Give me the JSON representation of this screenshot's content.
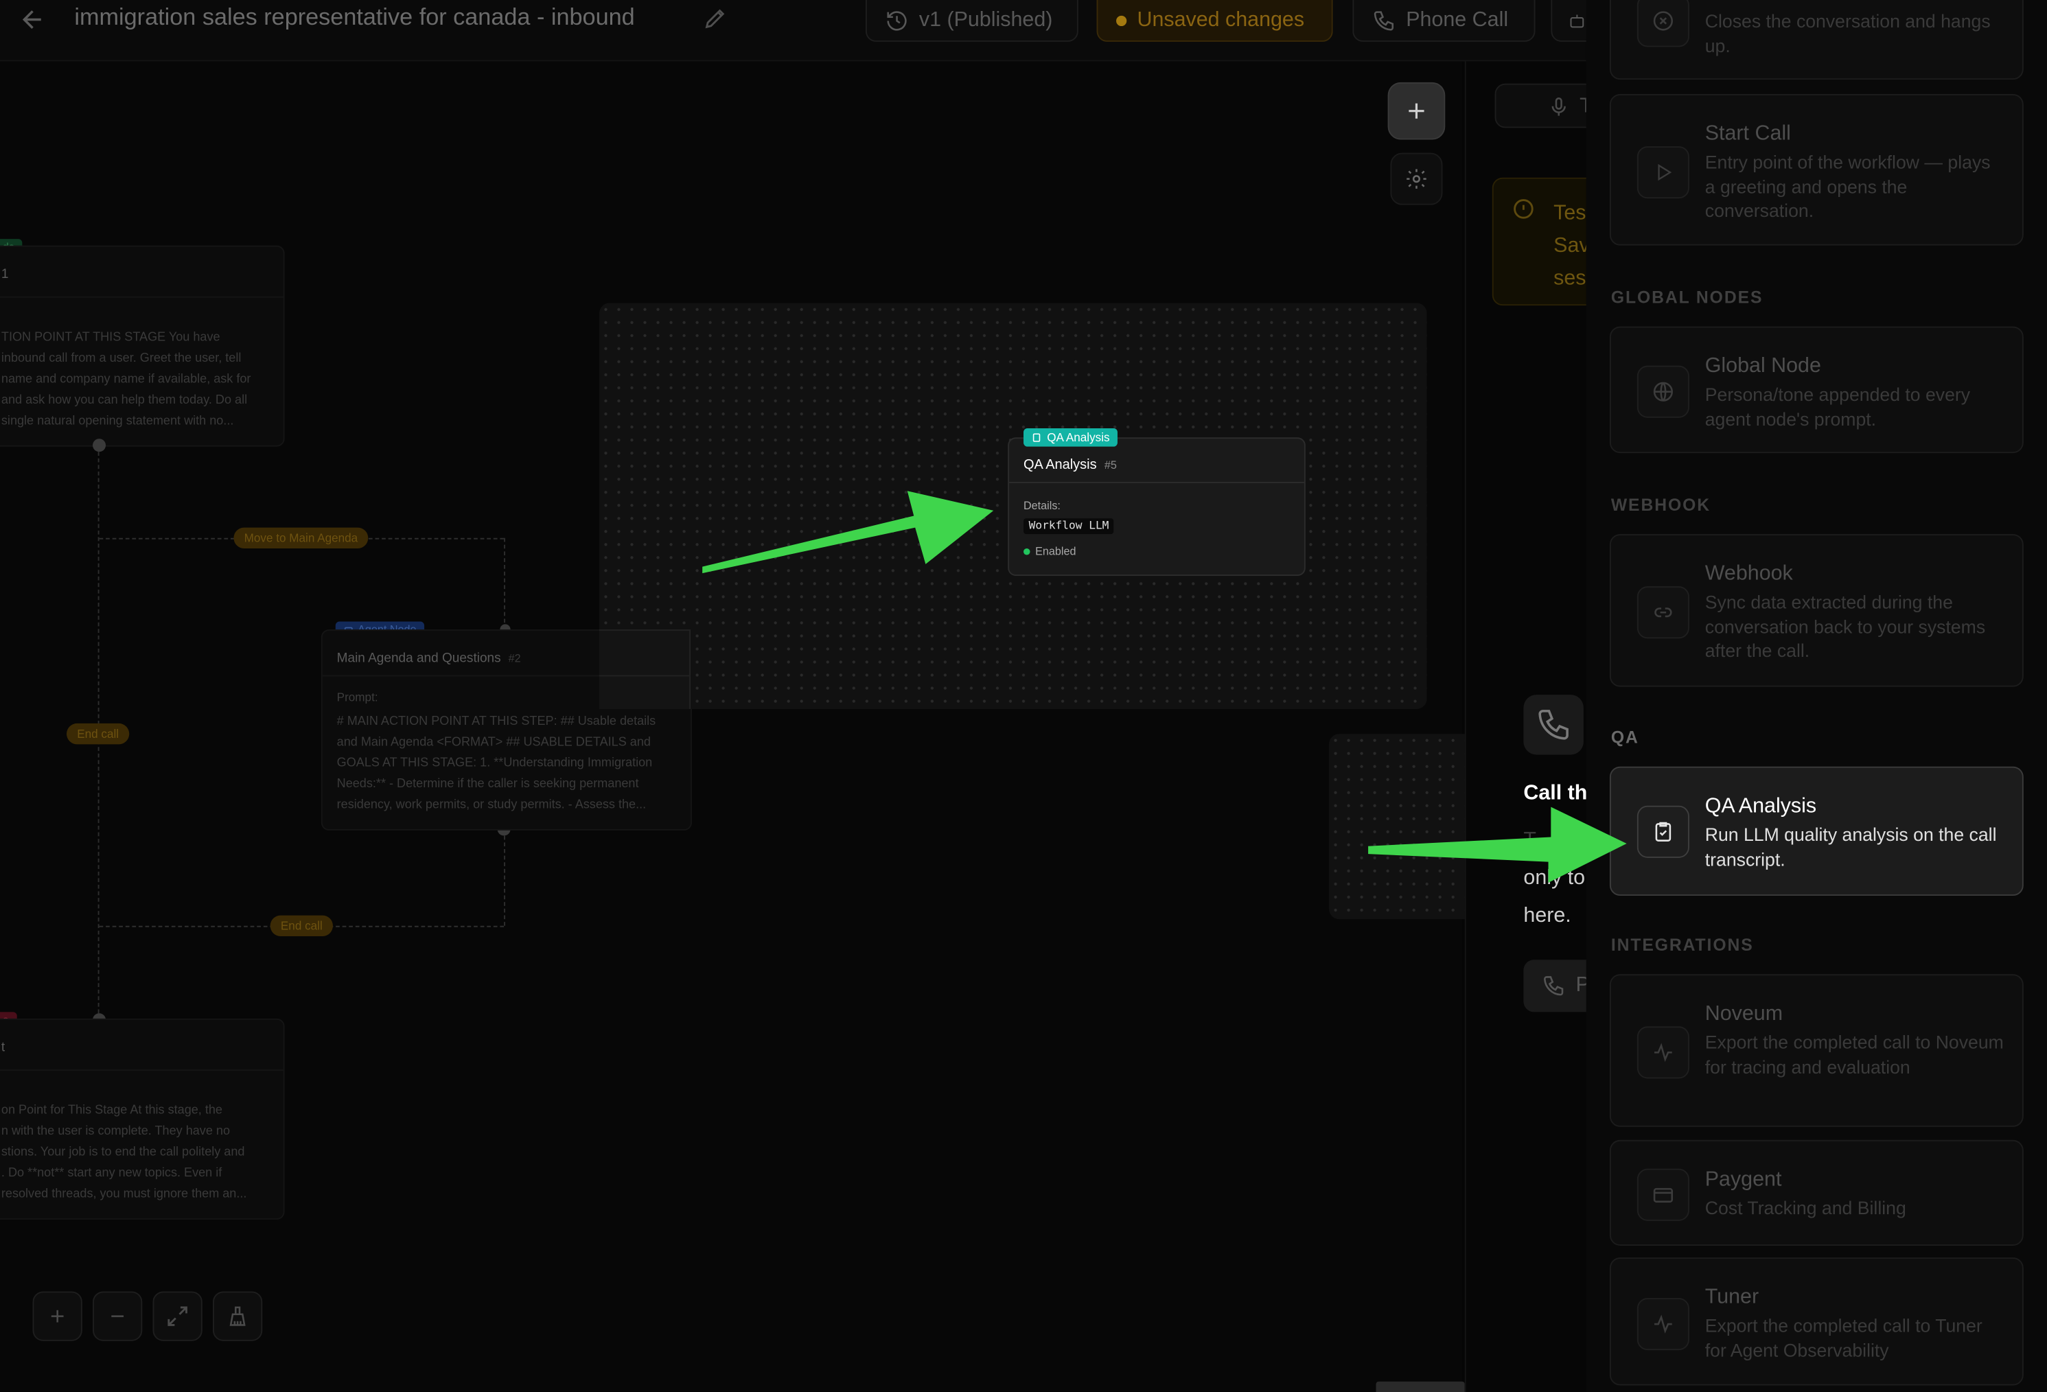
{
  "header": {
    "title": "immigration sales representative for canada - inbound",
    "version_label": "v1 (Published)",
    "unsaved_label": "Unsaved changes",
    "phone_call_label": "Phone Call"
  },
  "canvas": {
    "node_top": {
      "tag": "ds",
      "number": "1",
      "prompt_lines": [
        "TION POINT AT THIS STAGE You have",
        "inbound call from a user. Greet the user, tell",
        "name and company name if available, ask for",
        "and ask how you can help them today. Do all",
        "single natural opening statement with no..."
      ]
    },
    "edge_move_label": "Move to Main Agenda",
    "edge_end_call_left": "End call",
    "edge_end_call_bottom": "End call",
    "agent_node": {
      "tag": "Agent Node",
      "title": "Main Agenda and Questions",
      "number": "#2",
      "prompt_label": "Prompt:",
      "prompt_lines": [
        "# MAIN ACTION POINT AT THIS STEP: ## Usable details",
        "and Main Agenda <FORMAT> ## USABLE DETAILS and",
        "GOALS AT THIS STAGE: 1. **Understanding Immigration",
        "Needs:** - Determine if the caller is seeking permanent",
        "residency, work permits, or study permits. - Assess the..."
      ]
    },
    "node_bottom": {
      "tag": "e",
      "number": "t",
      "prompt_lines": [
        "on Point for This Stage At this stage, the",
        "n with the user is complete. They have no",
        "stions. Your job is to end the call politely and",
        ". Do **not** start any new topics. Even if",
        "resolved threads, you must ignore them an..."
      ]
    },
    "qa_node": {
      "tag": "QA Analysis",
      "title": "QA Analysis",
      "number": "#5",
      "details_label": "Details:",
      "model": "Workflow LLM",
      "status": "Enabled"
    }
  },
  "test_panel": {
    "mic_label": "T",
    "warning_lines": [
      "Tes",
      "Sav",
      "ses"
    ],
    "call_title": "Call th",
    "call_desc_lines": [
      "T",
      "only to",
      "here."
    ],
    "call_button_label": "P"
  },
  "palette": {
    "top_cards": [
      {
        "icon": "x-circle-icon",
        "title": "",
        "desc": "Closes the conversation and hangs up."
      },
      {
        "icon": "play-icon",
        "title": "Start Call",
        "desc": "Entry point of the workflow — plays a greeting and opens the conversation."
      }
    ],
    "global_section": "GLOBAL NODES",
    "global_card": {
      "icon": "globe-icon",
      "title": "Global Node",
      "desc": "Persona/tone appended to every agent node's prompt."
    },
    "webhook_section": "WEBHOOK",
    "webhook_card": {
      "icon": "link-icon",
      "title": "Webhook",
      "desc": "Sync data extracted during the conversation back to your systems after the call."
    },
    "qa_section": "QA",
    "qa_card": {
      "icon": "clipboard-check-icon",
      "title": "QA Analysis",
      "desc": "Run LLM quality analysis on the call transcript."
    },
    "integrations_section": "INTEGRATIONS",
    "integration_cards": [
      {
        "icon": "activity-icon",
        "title": "Noveum",
        "desc": "Export the completed call to Noveum for tracing and evaluation"
      },
      {
        "icon": "credit-card-icon",
        "title": "Paygent",
        "desc": "Cost Tracking and Billing"
      },
      {
        "icon": "activity-icon",
        "title": "Tuner",
        "desc": "Export the completed call to Tuner for Agent Observability"
      }
    ]
  },
  "colors": {
    "annotation_arrow": "#3fd54c",
    "qa_tag": "#12b4a5",
    "agent_tag": "#1a3f8a",
    "edge_pill": "#3b2a05",
    "enabled_dot": "#22c55e"
  }
}
